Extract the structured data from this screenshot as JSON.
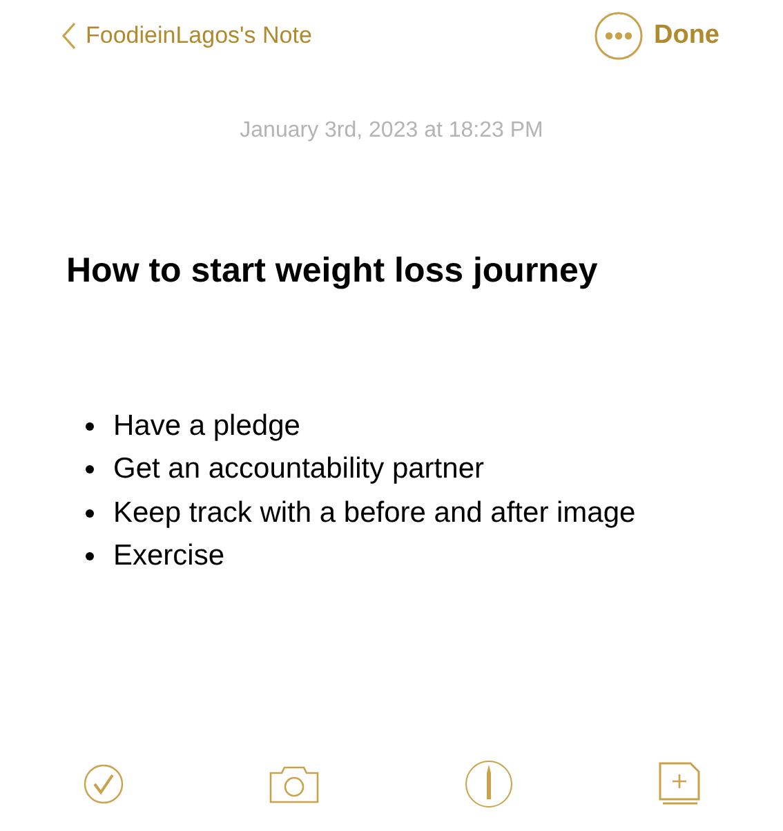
{
  "nav": {
    "back_label": "FoodieinLagos's Note",
    "done_label": "Done"
  },
  "note": {
    "date": "January 3rd, 2023 at 18:23 PM",
    "title": "How to start weight loss journey",
    "items": [
      "Have a pledge",
      "Get an accountability partner",
      "Keep track with a before and after image",
      "Exercise"
    ]
  },
  "toolbar": [
    {
      "kind": "checklist"
    },
    {
      "kind": "camera"
    },
    {
      "kind": "markup"
    },
    {
      "kind": "new-note"
    }
  ]
}
